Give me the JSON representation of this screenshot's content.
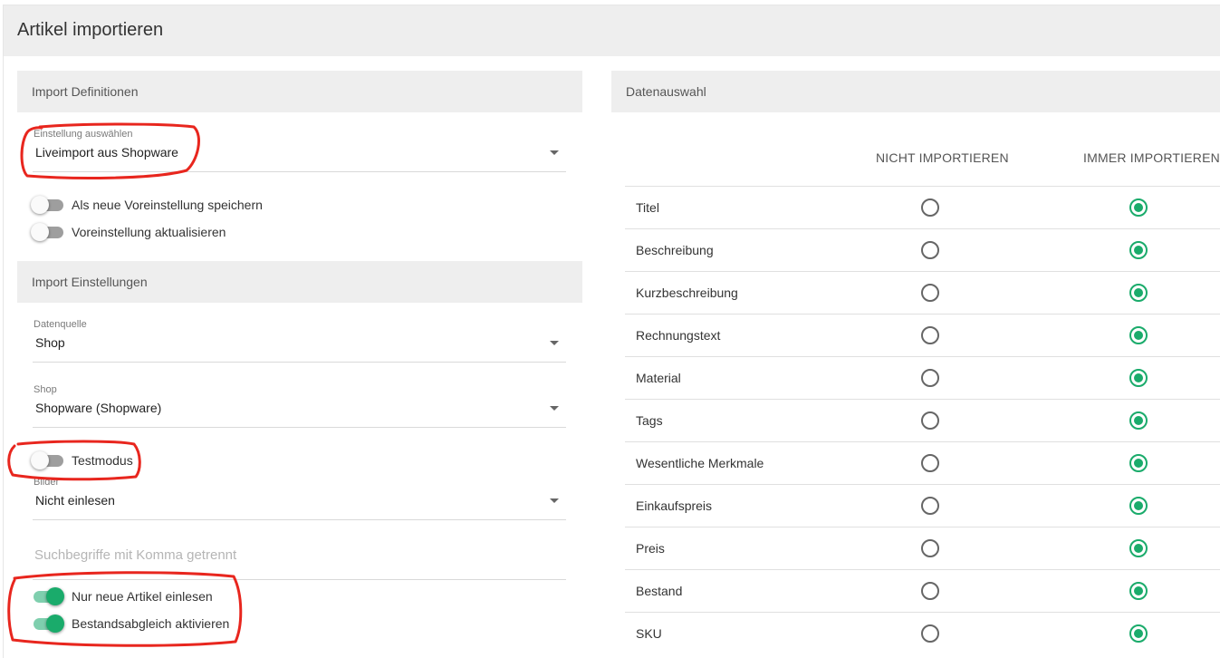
{
  "page": {
    "title": "Artikel importieren"
  },
  "left": {
    "import_definitions": {
      "header": "Import Definitionen",
      "setting_select": {
        "label": "Einstellung auswählen",
        "value": "Liveimport aus Shopware"
      },
      "toggles": [
        {
          "label": "Als neue Voreinstellung speichern",
          "checked": false
        },
        {
          "label": "Voreinstellung aktualisieren",
          "checked": false
        }
      ]
    },
    "import_settings": {
      "header": "Import Einstellungen",
      "datasource": {
        "label": "Datenquelle",
        "value": "Shop"
      },
      "shop": {
        "label": "Shop",
        "value": "Shopware (Shopware)"
      },
      "testmode": {
        "label": "Testmodus",
        "checked": false
      },
      "images": {
        "label": "Bilder",
        "value": "Nicht einlesen"
      },
      "search": {
        "placeholder": "Suchbegriffe mit Komma getrennt",
        "value": ""
      },
      "toggles": [
        {
          "label": "Nur neue Artikel einlesen",
          "checked": true
        },
        {
          "label": "Bestandsabgleich aktivieren",
          "checked": true
        }
      ]
    }
  },
  "right": {
    "header": "Datenauswahl",
    "columns": [
      "NICHT IMPORTIEREN",
      "IMMER IMPORTIEREN"
    ],
    "rows": [
      {
        "label": "Titel",
        "selected": "IMMER IMPORTIEREN"
      },
      {
        "label": "Beschreibung",
        "selected": "IMMER IMPORTIEREN"
      },
      {
        "label": "Kurzbeschreibung",
        "selected": "IMMER IMPORTIEREN"
      },
      {
        "label": "Rechnungstext",
        "selected": "IMMER IMPORTIEREN"
      },
      {
        "label": "Material",
        "selected": "IMMER IMPORTIEREN"
      },
      {
        "label": "Tags",
        "selected": "IMMER IMPORTIEREN"
      },
      {
        "label": "Wesentliche Merkmale",
        "selected": "IMMER IMPORTIEREN"
      },
      {
        "label": "Einkaufspreis",
        "selected": "IMMER IMPORTIEREN"
      },
      {
        "label": "Preis",
        "selected": "IMMER IMPORTIEREN"
      },
      {
        "label": "Bestand",
        "selected": "IMMER IMPORTIEREN"
      },
      {
        "label": "SKU",
        "selected": "IMMER IMPORTIEREN"
      }
    ]
  },
  "colors": {
    "accent": "#1aab6b",
    "accent_track": "#7fcfae",
    "annotation": "#e8261e",
    "section_bg": "#eeeeee"
  },
  "icons": {
    "select_caret": "caret-down-icon"
  }
}
